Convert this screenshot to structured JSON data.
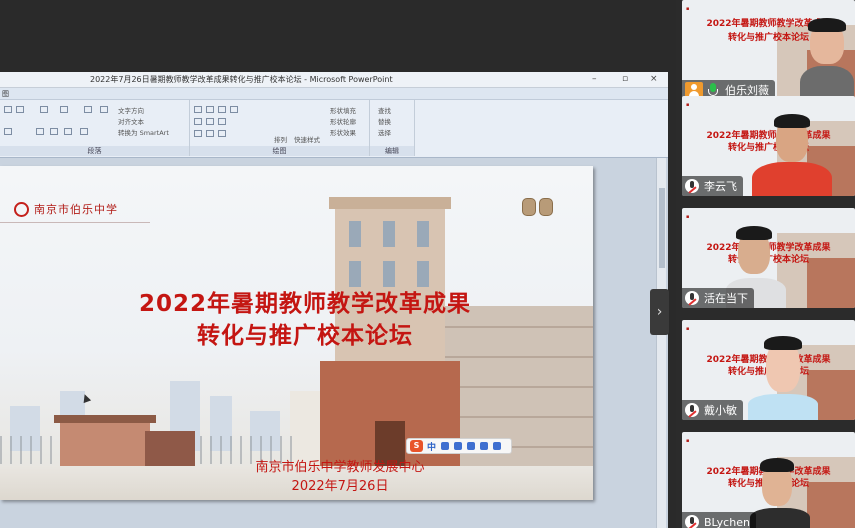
{
  "window": {
    "title": "2022年7月26日暑期教师教学改革成果转化与推广校本论坛 - Microsoft PowerPoint",
    "minimize": "–",
    "maximize": "▫",
    "close": "×"
  },
  "ribbon": {
    "tab": "图",
    "group_paragraph": "段落",
    "group_drawing": "绘图",
    "group_editing": "编辑",
    "text_direction": "文字方向",
    "align_text": "对齐文本",
    "convert_smartart": "转换为 SmartArt",
    "arrange": "排列",
    "quick_styles": "快速样式",
    "shape_fill": "形状填充",
    "shape_outline": "形状轮廓",
    "shape_effects": "形状效果",
    "find": "查找",
    "replace": "替换",
    "select": "选择"
  },
  "slide": {
    "school_logo_text": "南京市伯乐中学",
    "title_line1": "2022年暑期教师教学改革成果",
    "title_line2": "转化与推广校本论坛",
    "organizer": "南京市伯乐中学教师发展中心",
    "date": "2022年7月26日"
  },
  "ime_toolbar": {
    "logo": "S",
    "mode": "中"
  },
  "participants": [
    {
      "name": "伯乐刘薇",
      "mic": "on",
      "video": "camera"
    },
    {
      "name": "李云飞",
      "mic": "muted",
      "video": "camera"
    },
    {
      "name": "活在当下",
      "mic": "muted",
      "video": "camera"
    },
    {
      "name": "戴小敏",
      "mic": "muted",
      "video": "camera"
    },
    {
      "name": "BLychen",
      "mic": "muted",
      "video": "camera"
    }
  ],
  "tile_slide": {
    "line1": "2022年暑期教师教学改革成果",
    "line2": "转化与推广校本论坛"
  },
  "colors": {
    "title_red": "#c41612",
    "panel_bg": "#2b2b2b",
    "mic_on": "#2bbf4a"
  }
}
